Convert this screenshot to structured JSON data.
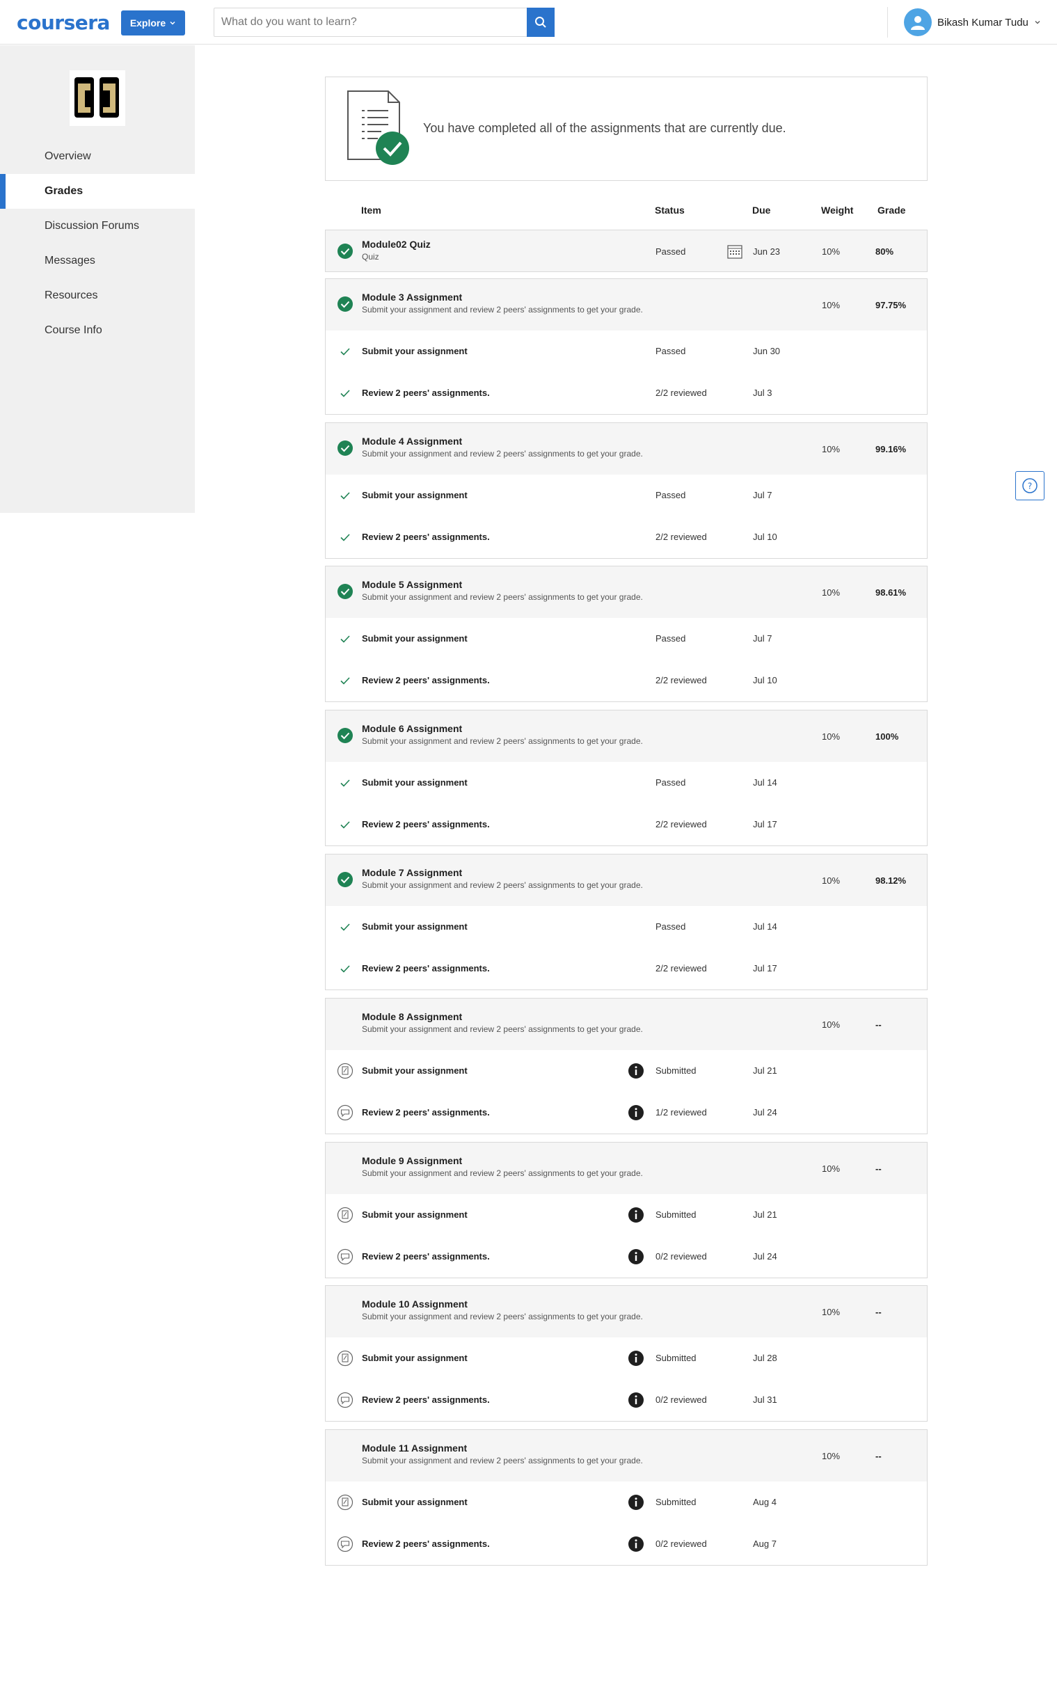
{
  "header": {
    "logo": "coursera",
    "explore_label": "Explore",
    "search_placeholder": "What do you want to learn?",
    "user_name": "Bikash Kumar Tudu"
  },
  "sidebar": {
    "items": [
      {
        "label": "Overview"
      },
      {
        "label": "Grades"
      },
      {
        "label": "Discussion Forums"
      },
      {
        "label": "Messages"
      },
      {
        "label": "Resources"
      },
      {
        "label": "Course Info"
      }
    ],
    "active": "Grades"
  },
  "banner": {
    "message": "You have completed all of the assignments that are currently due."
  },
  "table": {
    "headers": {
      "item": "Item",
      "status": "Status",
      "due": "Due",
      "weight": "Weight",
      "grade": "Grade"
    },
    "quiz": {
      "title": "Module02 Quiz",
      "subtitle": "Quiz",
      "status": "Passed",
      "due": "Jun 23",
      "weight": "10%",
      "grade": "80%"
    },
    "modules": [
      {
        "title": "Module 3 Assignment",
        "subtitle": "Submit your assignment and review 2 peers' assignments to get your grade.",
        "weight": "10%",
        "grade": "97.75%",
        "complete": true,
        "submit": {
          "label": "Submit your assignment",
          "status": "Passed",
          "due": "Jun 30"
        },
        "review": {
          "label": "Review 2 peers' assignments.",
          "status": "2/2 reviewed",
          "due": "Jul 3"
        }
      },
      {
        "title": "Module 4 Assignment",
        "subtitle": "Submit your assignment and review 2 peers' assignments to get your grade.",
        "weight": "10%",
        "grade": "99.16%",
        "complete": true,
        "submit": {
          "label": "Submit your assignment",
          "status": "Passed",
          "due": "Jul 7"
        },
        "review": {
          "label": "Review 2 peers' assignments.",
          "status": "2/2 reviewed",
          "due": "Jul 10"
        }
      },
      {
        "title": "Module 5 Assignment",
        "subtitle": "Submit your assignment and review 2 peers' assignments to get your grade.",
        "weight": "10%",
        "grade": "98.61%",
        "complete": true,
        "submit": {
          "label": "Submit your assignment",
          "status": "Passed",
          "due": "Jul 7"
        },
        "review": {
          "label": "Review 2 peers' assignments.",
          "status": "2/2 reviewed",
          "due": "Jul 10"
        }
      },
      {
        "title": "Module 6 Assignment",
        "subtitle": "Submit your assignment and review 2 peers' assignments to get your grade.",
        "weight": "10%",
        "grade": "100%",
        "complete": true,
        "submit": {
          "label": "Submit your assignment",
          "status": "Passed",
          "due": "Jul 14"
        },
        "review": {
          "label": "Review 2 peers' assignments.",
          "status": "2/2 reviewed",
          "due": "Jul 17"
        }
      },
      {
        "title": "Module 7 Assignment",
        "subtitle": "Submit your assignment and review 2 peers' assignments to get your grade.",
        "weight": "10%",
        "grade": "98.12%",
        "complete": true,
        "submit": {
          "label": "Submit your assignment",
          "status": "Passed",
          "due": "Jul 14"
        },
        "review": {
          "label": "Review 2 peers' assignments.",
          "status": "2/2 reviewed",
          "due": "Jul 17"
        }
      },
      {
        "title": "Module 8 Assignment",
        "subtitle": "Submit your assignment and review 2 peers' assignments to get your grade.",
        "weight": "10%",
        "grade": "--",
        "complete": false,
        "submit": {
          "label": "Submit your assignment",
          "status": "Submitted",
          "due": "Jul 21"
        },
        "review": {
          "label": "Review 2 peers' assignments.",
          "status": "1/2 reviewed",
          "due": "Jul 24"
        }
      },
      {
        "title": "Module 9 Assignment",
        "subtitle": "Submit your assignment and review 2 peers' assignments to get your grade.",
        "weight": "10%",
        "grade": "--",
        "complete": false,
        "submit": {
          "label": "Submit your assignment",
          "status": "Submitted",
          "due": "Jul 21"
        },
        "review": {
          "label": "Review 2 peers' assignments.",
          "status": "0/2 reviewed",
          "due": "Jul 24"
        }
      },
      {
        "title": "Module 10 Assignment",
        "subtitle": "Submit your assignment and review 2 peers' assignments to get your grade.",
        "weight": "10%",
        "grade": "--",
        "complete": false,
        "submit": {
          "label": "Submit your assignment",
          "status": "Submitted",
          "due": "Jul 28"
        },
        "review": {
          "label": "Review 2 peers' assignments.",
          "status": "0/2 reviewed",
          "due": "Jul 31"
        }
      },
      {
        "title": "Module 11 Assignment",
        "subtitle": "Submit your assignment and review 2 peers' assignments to get your grade.",
        "weight": "10%",
        "grade": "--",
        "complete": false,
        "submit": {
          "label": "Submit your assignment",
          "status": "Submitted",
          "due": "Aug 4"
        },
        "review": {
          "label": "Review 2 peers' assignments.",
          "status": "0/2 reviewed",
          "due": "Aug 7"
        }
      }
    ]
  },
  "colors": {
    "brand": "#2a73cc",
    "success": "#1f8354",
    "sidebar_bg": "#f0f0f0",
    "info": "#1f1f1f"
  }
}
